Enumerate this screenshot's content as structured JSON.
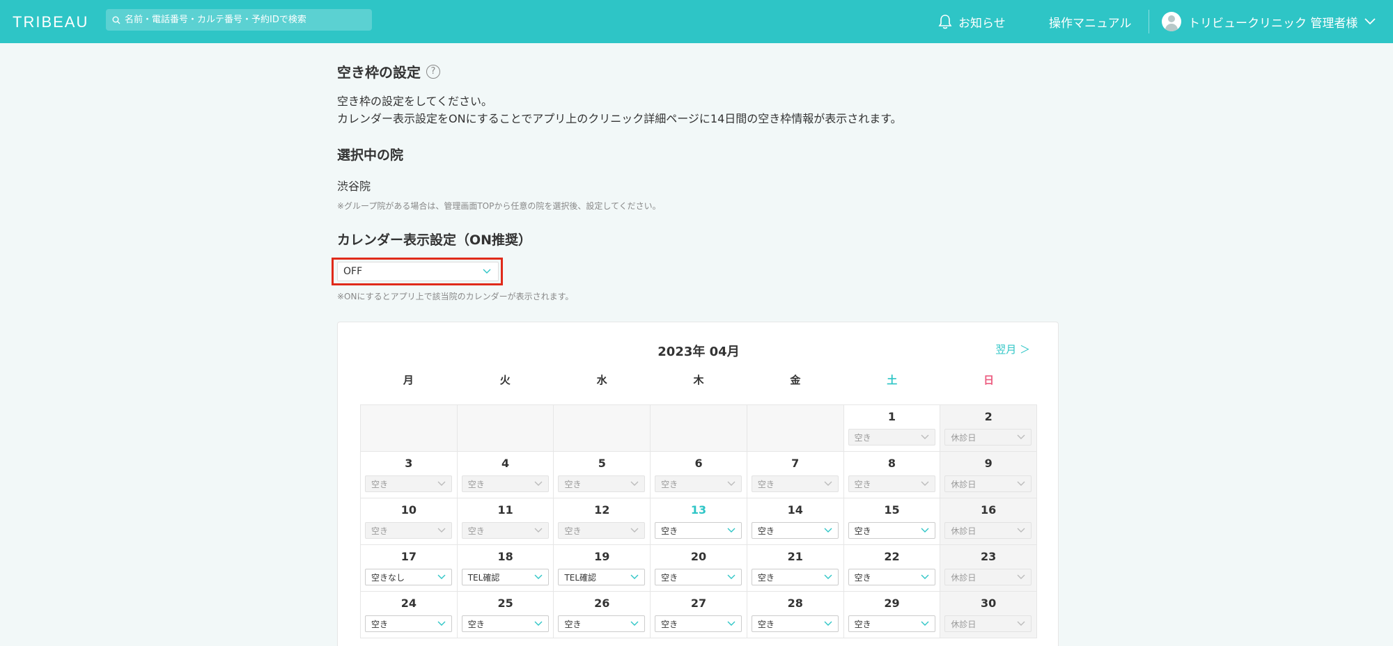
{
  "header": {
    "logo": "TRIBEAU",
    "search_placeholder": "名前・電話番号・カルテ番号・予約IDで検索",
    "notice_label": "お知らせ",
    "manual_label": "操作マニュアル",
    "user_label": "トリビュークリニック 管理者様"
  },
  "page": {
    "title": "空き枠の設定",
    "description_line1": "空き枠の設定をしてください。",
    "description_line2": "カレンダー表示設定をONにすることでアプリ上のクリニック詳細ページに14日間の空き枠情報が表示されます。",
    "selected_heading": "選択中の院",
    "clinic_name": "渋谷院",
    "clinic_note": "※グループ院がある場合は、管理画面TOPから任意の院を選択後、設定してください。",
    "calendar_heading": "カレンダー表示設定（ON推奨）",
    "calendar_display_value": "OFF",
    "calendar_note": "※ONにするとアプリ上で該当院のカレンダーが表示されます。"
  },
  "calendar": {
    "month_title": "2023年 04月",
    "next_label": "翌月 ＞",
    "weekdays": [
      "月",
      "火",
      "水",
      "木",
      "金",
      "土",
      "日"
    ],
    "weeks": [
      [
        null,
        null,
        null,
        null,
        null,
        {
          "day": "1",
          "status": "空き",
          "enabled": false
        },
        {
          "day": "2",
          "status": "休診日",
          "enabled": false
        }
      ],
      [
        {
          "day": "3",
          "status": "空き",
          "enabled": false
        },
        {
          "day": "4",
          "status": "空き",
          "enabled": false
        },
        {
          "day": "5",
          "status": "空き",
          "enabled": false
        },
        {
          "day": "6",
          "status": "空き",
          "enabled": false
        },
        {
          "day": "7",
          "status": "空き",
          "enabled": false
        },
        {
          "day": "8",
          "status": "空き",
          "enabled": false
        },
        {
          "day": "9",
          "status": "休診日",
          "enabled": false
        }
      ],
      [
        {
          "day": "10",
          "status": "空き",
          "enabled": false
        },
        {
          "day": "11",
          "status": "空き",
          "enabled": false
        },
        {
          "day": "12",
          "status": "空き",
          "enabled": false
        },
        {
          "day": "13",
          "status": "空き",
          "enabled": true,
          "today": true
        },
        {
          "day": "14",
          "status": "空き",
          "enabled": true
        },
        {
          "day": "15",
          "status": "空き",
          "enabled": true
        },
        {
          "day": "16",
          "status": "休診日",
          "enabled": false
        }
      ],
      [
        {
          "day": "17",
          "status": "空きなし",
          "enabled": true
        },
        {
          "day": "18",
          "status": "TEL確認",
          "enabled": true
        },
        {
          "day": "19",
          "status": "TEL確認",
          "enabled": true
        },
        {
          "day": "20",
          "status": "空き",
          "enabled": true
        },
        {
          "day": "21",
          "status": "空き",
          "enabled": true
        },
        {
          "day": "22",
          "status": "空き",
          "enabled": true
        },
        {
          "day": "23",
          "status": "休診日",
          "enabled": false
        }
      ],
      [
        {
          "day": "24",
          "status": "空き",
          "enabled": true
        },
        {
          "day": "25",
          "status": "空き",
          "enabled": true
        },
        {
          "day": "26",
          "status": "空き",
          "enabled": true
        },
        {
          "day": "27",
          "status": "空き",
          "enabled": true
        },
        {
          "day": "28",
          "status": "空き",
          "enabled": true
        },
        {
          "day": "29",
          "status": "空き",
          "enabled": true
        },
        {
          "day": "30",
          "status": "休診日",
          "enabled": false
        }
      ]
    ]
  },
  "colors": {
    "accent": "#2ec5c6",
    "sunday": "#ec5c80",
    "highlight_frame": "#e02a1a"
  }
}
